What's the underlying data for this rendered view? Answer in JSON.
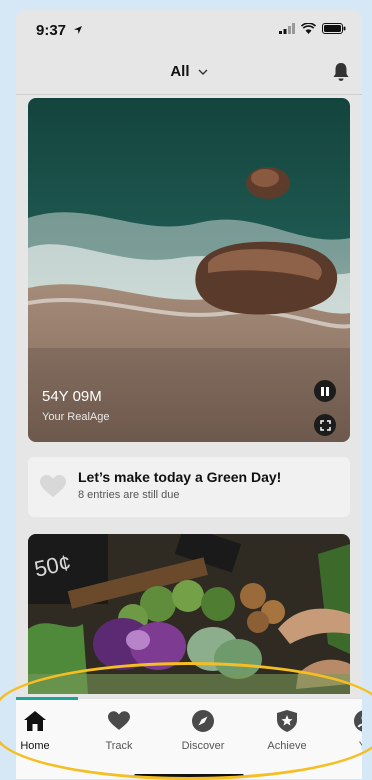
{
  "status": {
    "time": "9:37"
  },
  "header": {
    "filter_label": "All"
  },
  "hero": {
    "age_value": "54Y 09M",
    "age_label": "Your RealAge"
  },
  "green_day": {
    "title": "Let’s make today a Green Day!",
    "subtitle": "8 entries are still due"
  },
  "tabs": [
    {
      "label": "Home",
      "icon": "home-icon",
      "active": true
    },
    {
      "label": "Track",
      "icon": "heart-icon"
    },
    {
      "label": "Discover",
      "icon": "compass-icon"
    },
    {
      "label": "Achieve",
      "icon": "shield-star-icon"
    },
    {
      "label": "Yo",
      "icon": "profile-icon"
    }
  ],
  "colors": {
    "accent": "#1ba69a",
    "highlight": "#f5be22",
    "background": "#d6e8f6"
  }
}
